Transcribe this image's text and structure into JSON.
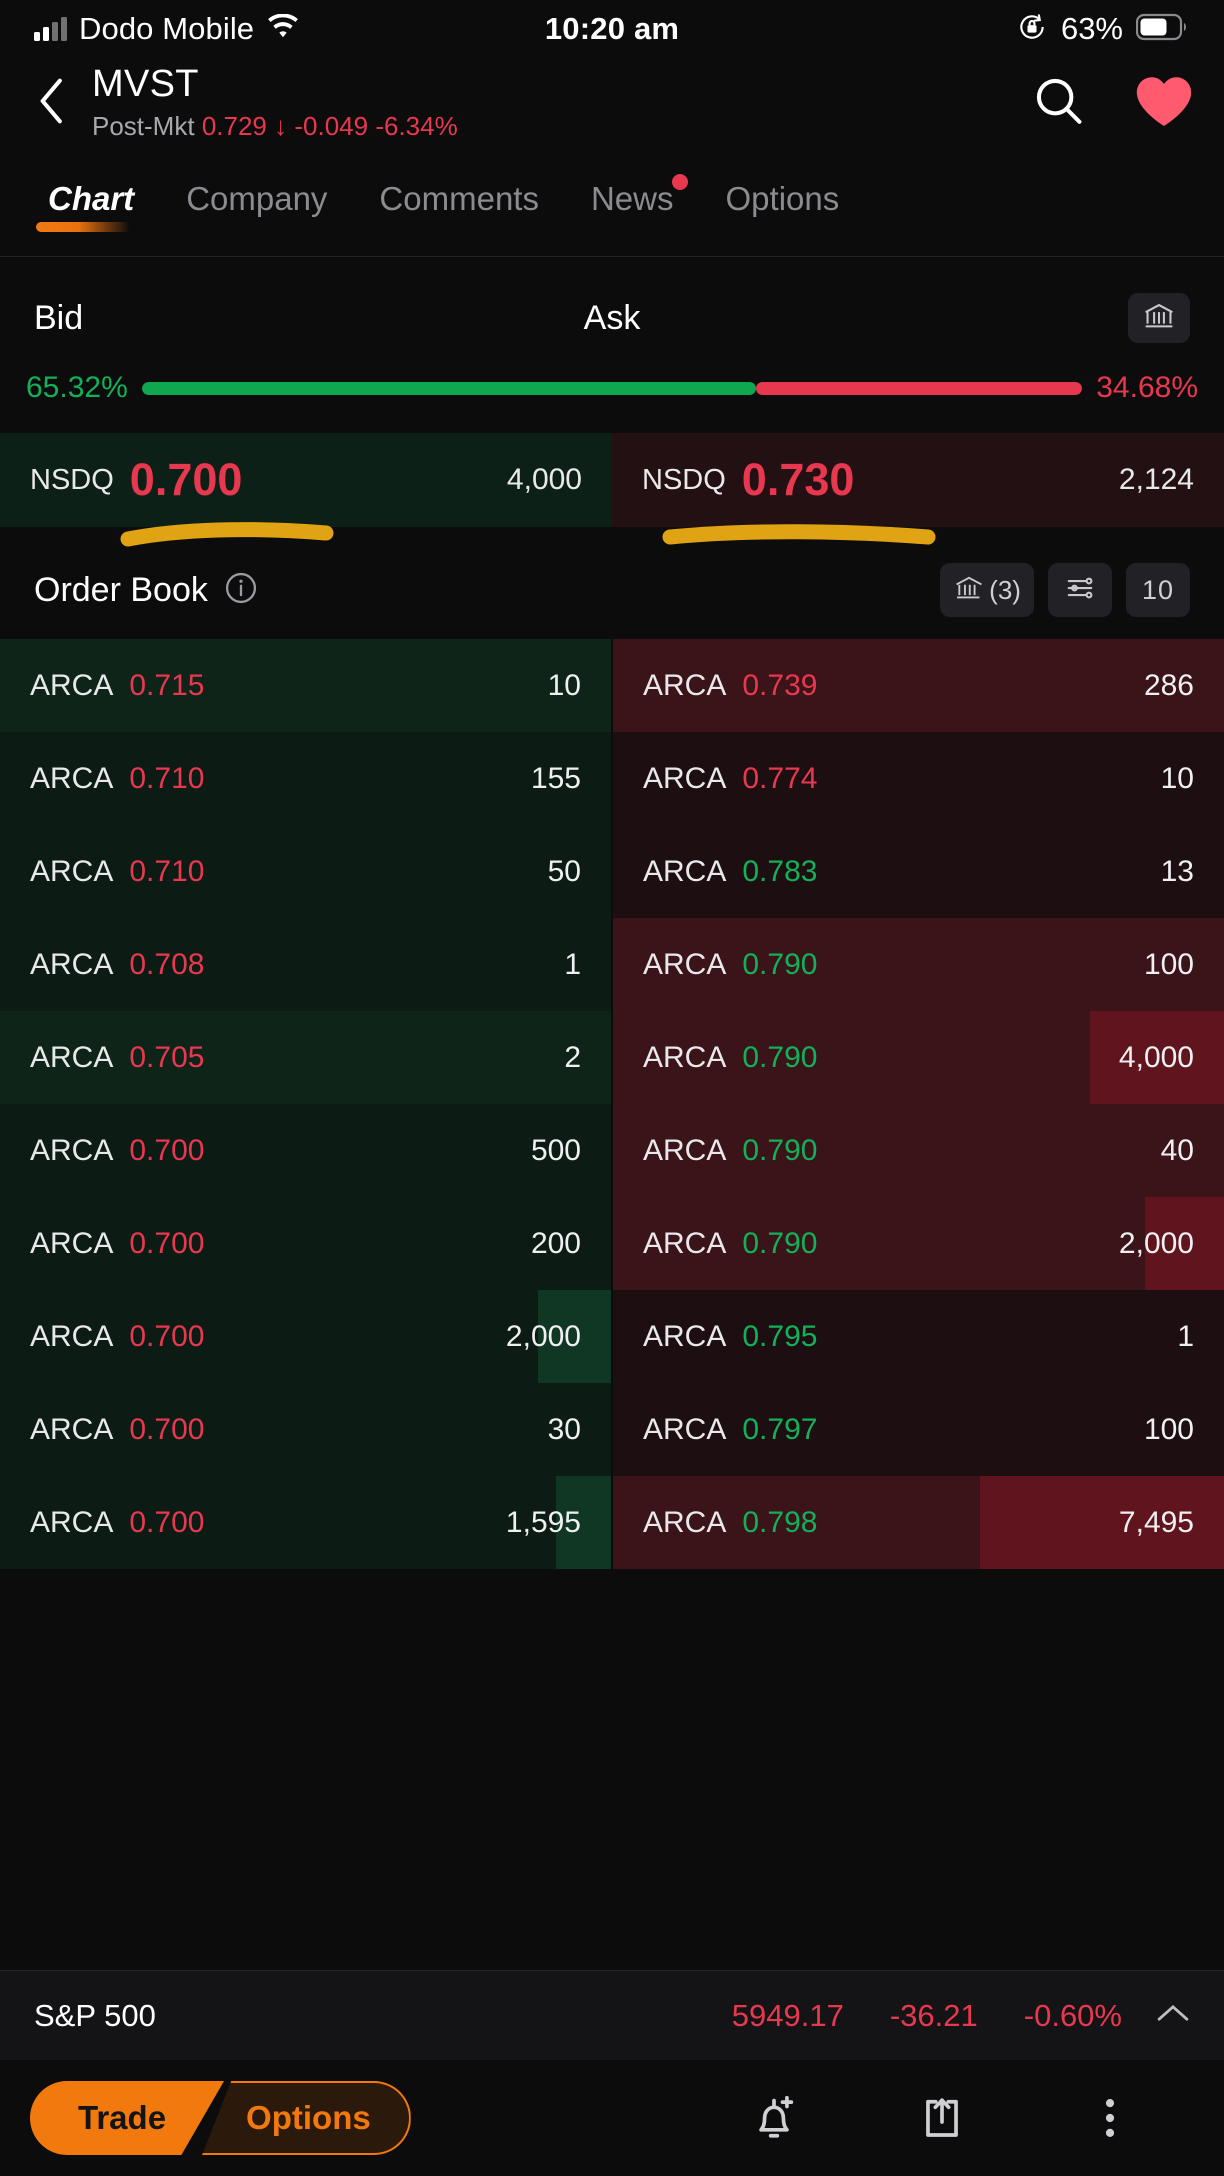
{
  "status_bar": {
    "carrier": "Dodo Mobile",
    "time": "10:20 am",
    "battery_pct": "63%",
    "icons": [
      "signal-bars-icon",
      "wifi-icon",
      "rotation-lock-icon",
      "battery-icon"
    ]
  },
  "header": {
    "back_icon": "chevron-left-icon",
    "symbol": "MVST",
    "session_label": "Post-Mkt",
    "price": "0.729",
    "direction_icon": "arrow-down-icon",
    "change": "-0.049",
    "change_pct": "-6.34%",
    "search_icon": "search-icon",
    "favorite_icon": "heart-icon",
    "favorite_color": "#ff5a6e"
  },
  "tabs": [
    {
      "label": "Chart",
      "active": true,
      "badge": false
    },
    {
      "label": "Company",
      "active": false,
      "badge": false
    },
    {
      "label": "Comments",
      "active": false,
      "badge": false
    },
    {
      "label": "News",
      "active": false,
      "badge": true
    },
    {
      "label": "Options",
      "active": false,
      "badge": false
    }
  ],
  "bid_ask": {
    "bid_label": "Bid",
    "ask_label": "Ask",
    "exchange_icon": "bank-icon",
    "bid_pct": "65.32%",
    "ask_pct": "34.68%",
    "bid_ratio": 65.32,
    "ask_ratio": 34.68,
    "bid": {
      "venue": "NSDQ",
      "price": "0.700",
      "size": "4,000"
    },
    "ask": {
      "venue": "NSDQ",
      "price": "0.730",
      "size": "2,124"
    },
    "annotations": [
      "underline-highlight-bid",
      "underline-highlight-ask"
    ],
    "annotation_color": "#e0a313"
  },
  "order_book": {
    "title": "Order Book",
    "info_icon": "info-icon",
    "buttons": [
      {
        "name": "exchange-filter-button",
        "icon": "bank-icon",
        "label": "(3)"
      },
      {
        "name": "settings-button",
        "icon": "sliders-icon",
        "label": ""
      },
      {
        "name": "depth-button",
        "icon": "",
        "label": "10"
      }
    ],
    "rows": [
      {
        "bid": {
          "venue": "ARCA",
          "price": "0.715",
          "dir": "down",
          "size": "10",
          "fill": 0,
          "alt": true
        },
        "ask": {
          "venue": "ARCA",
          "price": "0.739",
          "dir": "down",
          "size": "286",
          "fill": 0,
          "alt": true
        }
      },
      {
        "bid": {
          "venue": "ARCA",
          "price": "0.710",
          "dir": "down",
          "size": "155",
          "fill": 0,
          "alt": false
        },
        "ask": {
          "venue": "ARCA",
          "price": "0.774",
          "dir": "down",
          "size": "10",
          "fill": 0,
          "alt": false
        }
      },
      {
        "bid": {
          "venue": "ARCA",
          "price": "0.710",
          "dir": "down",
          "size": "50",
          "fill": 0,
          "alt": false
        },
        "ask": {
          "venue": "ARCA",
          "price": "0.783",
          "dir": "up",
          "size": "13",
          "fill": 0,
          "alt": false
        }
      },
      {
        "bid": {
          "venue": "ARCA",
          "price": "0.708",
          "dir": "down",
          "size": "1",
          "fill": 0,
          "alt": false
        },
        "ask": {
          "venue": "ARCA",
          "price": "0.790",
          "dir": "up",
          "size": "100",
          "fill": 0,
          "alt": true
        }
      },
      {
        "bid": {
          "venue": "ARCA",
          "price": "0.705",
          "dir": "down",
          "size": "2",
          "fill": 0,
          "alt": true
        },
        "ask": {
          "venue": "ARCA",
          "price": "0.790",
          "dir": "up",
          "size": "4,000",
          "fill": 22,
          "alt": true
        }
      },
      {
        "bid": {
          "venue": "ARCA",
          "price": "0.700",
          "dir": "down",
          "size": "500",
          "fill": 0,
          "alt": false
        },
        "ask": {
          "venue": "ARCA",
          "price": "0.790",
          "dir": "up",
          "size": "40",
          "fill": 0,
          "alt": true
        }
      },
      {
        "bid": {
          "venue": "ARCA",
          "price": "0.700",
          "dir": "down",
          "size": "200",
          "fill": 0,
          "alt": false
        },
        "ask": {
          "venue": "ARCA",
          "price": "0.790",
          "dir": "up",
          "size": "2,000",
          "fill": 13,
          "alt": true
        }
      },
      {
        "bid": {
          "venue": "ARCA",
          "price": "0.700",
          "dir": "down",
          "size": "2,000",
          "fill": 12,
          "alt": false
        },
        "ask": {
          "venue": "ARCA",
          "price": "0.795",
          "dir": "up",
          "size": "1",
          "fill": 0,
          "alt": false
        }
      },
      {
        "bid": {
          "venue": "ARCA",
          "price": "0.700",
          "dir": "down",
          "size": "30",
          "fill": 0,
          "alt": false
        },
        "ask": {
          "venue": "ARCA",
          "price": "0.797",
          "dir": "up",
          "size": "100",
          "fill": 0,
          "alt": false
        }
      },
      {
        "bid": {
          "venue": "ARCA",
          "price": "0.700",
          "dir": "down",
          "size": "1,595",
          "fill": 9,
          "alt": false
        },
        "ask": {
          "venue": "ARCA",
          "price": "0.798",
          "dir": "up",
          "size": "7,495",
          "fill": 40,
          "alt": true
        }
      }
    ]
  },
  "index_bar": {
    "name": "S&P 500",
    "value": "5949.17",
    "change": "-36.21",
    "change_pct": "-0.60%",
    "chevron_icon": "chevron-up-icon"
  },
  "toolbar": {
    "trade_label": "Trade",
    "options_label": "Options",
    "icons": [
      "bell-plus-icon",
      "share-icon",
      "more-vertical-icon"
    ]
  },
  "colors": {
    "up": "#13b05a",
    "down": "#e8384f",
    "accent": "#f2790d",
    "background": "#0c0c0d"
  }
}
